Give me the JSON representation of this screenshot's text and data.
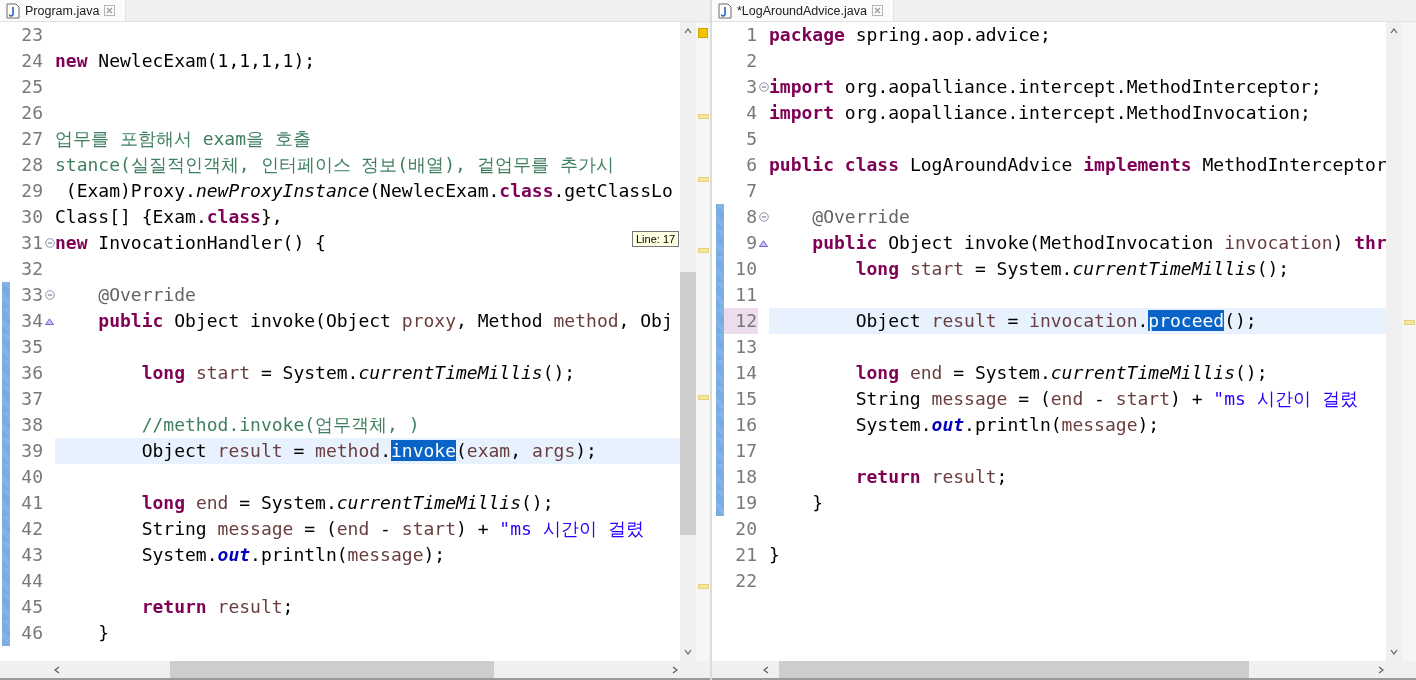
{
  "panes": [
    {
      "tab": {
        "title": "Program.java"
      },
      "focused": false,
      "tooltip": "Line: 17",
      "lines": [
        {
          "number": "23",
          "current": false
        },
        {
          "number": "24",
          "kind": "top",
          "current": false,
          "tokens": [
            {
              "kind": "keyword",
              "text": "new"
            },
            {
              "kind": "plain",
              "text": " NewlecExam(1,1,1,1);"
            }
          ]
        },
        {
          "number": "25",
          "current": false
        },
        {
          "number": "26",
          "current": false
        },
        {
          "number": "27",
          "kind": "top",
          "current": false,
          "tokens": [
            {
              "kind": "comment",
              "text": "업무를 포함해서 exam을 호출"
            }
          ]
        },
        {
          "number": "28",
          "kind": "top",
          "current": false,
          "tokens": [
            {
              "kind": "comment",
              "text": "stance(실질적인객체, 인터페이스 정보(배열), 겉업무를 추가시"
            }
          ]
        },
        {
          "number": "29",
          "kind": "top",
          "current": false,
          "tokens": [
            {
              "kind": "plain",
              "text": " (Exam)Proxy."
            },
            {
              "kind": "static",
              "text": "newProxyInstance"
            },
            {
              "kind": "plain",
              "text": "(NewlecExam."
            },
            {
              "kind": "keyword",
              "text": "class"
            },
            {
              "kind": "plain",
              "text": ".getClassLo"
            }
          ]
        },
        {
          "number": "30",
          "kind": "top",
          "current": false,
          "tokens": [
            {
              "kind": "plain",
              "text": "Class[] {Exam."
            },
            {
              "kind": "keyword",
              "text": "class"
            },
            {
              "kind": "plain",
              "text": "},"
            }
          ]
        },
        {
          "number": "31",
          "kind": "top",
          "current": false,
          "folding": true,
          "tokens": [
            {
              "kind": "keyword",
              "text": "new"
            },
            {
              "kind": "plain",
              "text": " InvocationHandler() {"
            }
          ]
        },
        {
          "number": "32",
          "current": false
        },
        {
          "number": "33",
          "kind": "member",
          "current": false,
          "folding": true,
          "changed": true,
          "tokens": [
            {
              "kind": "annotation",
              "text": "@Override"
            }
          ]
        },
        {
          "number": "34",
          "kind": "member",
          "current": false,
          "override": true,
          "changed": true,
          "tokens": [
            {
              "kind": "keyword",
              "text": "public"
            },
            {
              "kind": "plain",
              "text": " Object invoke(Object "
            },
            {
              "kind": "variable",
              "text": "proxy"
            },
            {
              "kind": "plain",
              "text": ", Method "
            },
            {
              "kind": "variable",
              "text": "method"
            },
            {
              "kind": "plain",
              "text": ", Obj"
            }
          ]
        },
        {
          "number": "35",
          "current": false,
          "changed": true
        },
        {
          "number": "36",
          "kind": "statement",
          "current": false,
          "changed": true,
          "tokens": [
            {
              "kind": "keyword",
              "text": "long "
            },
            {
              "kind": "variable",
              "text": "start"
            },
            {
              "kind": "plain",
              "text": " = System."
            },
            {
              "kind": "static",
              "text": "currentTimeMillis"
            },
            {
              "kind": "plain",
              "text": "();"
            }
          ]
        },
        {
          "number": "37",
          "current": false,
          "changed": true
        },
        {
          "number": "38",
          "kind": "statement",
          "current": false,
          "changed": true,
          "tokens": [
            {
              "kind": "comment",
              "text": "//method.invoke(업무객체, )"
            }
          ]
        },
        {
          "number": "39",
          "kind": "statement",
          "current": true,
          "changed": true,
          "tokens": [
            {
              "kind": "plain",
              "text": "Object "
            },
            {
              "kind": "variable",
              "text": "result"
            },
            {
              "kind": "plain",
              "text": " = "
            },
            {
              "kind": "variable",
              "text": "method"
            },
            {
              "kind": "plain",
              "text": "."
            },
            {
              "kind": "selection",
              "text": "invoke"
            },
            {
              "kind": "plain",
              "text": "("
            },
            {
              "kind": "variable",
              "text": "exam"
            },
            {
              "kind": "plain",
              "text": ", "
            },
            {
              "kind": "variable",
              "text": "args"
            },
            {
              "kind": "plain",
              "text": ");"
            }
          ]
        },
        {
          "number": "40",
          "current": false,
          "changed": true
        },
        {
          "number": "41",
          "kind": "statement",
          "current": false,
          "changed": true,
          "tokens": [
            {
              "kind": "keyword",
              "text": "long "
            },
            {
              "kind": "variable",
              "text": "end"
            },
            {
              "kind": "plain",
              "text": " = System."
            },
            {
              "kind": "static",
              "text": "currentTimeMillis"
            },
            {
              "kind": "plain",
              "text": "();"
            }
          ]
        },
        {
          "number": "42",
          "kind": "statement",
          "current": false,
          "changed": true,
          "tokens": [
            {
              "kind": "plain",
              "text": "String "
            },
            {
              "kind": "variable",
              "text": "message"
            },
            {
              "kind": "plain",
              "text": " = ("
            },
            {
              "kind": "variable",
              "text": "end"
            },
            {
              "kind": "plain",
              "text": " - "
            },
            {
              "kind": "variable",
              "text": "start"
            },
            {
              "kind": "plain",
              "text": ") + "
            },
            {
              "kind": "string",
              "text": "\"ms 시간이 걸렸"
            }
          ]
        },
        {
          "number": "43",
          "kind": "statement",
          "current": false,
          "changed": true,
          "tokens": [
            {
              "kind": "plain",
              "text": "System."
            },
            {
              "kind": "static_field",
              "text": "out"
            },
            {
              "kind": "plain",
              "text": ".println("
            },
            {
              "kind": "variable",
              "text": "message"
            },
            {
              "kind": "plain",
              "text": ");"
            }
          ]
        },
        {
          "number": "44",
          "current": false,
          "changed": true
        },
        {
          "number": "45",
          "kind": "statement",
          "current": false,
          "changed": true,
          "tokens": [
            {
              "kind": "keyword",
              "text": "return "
            },
            {
              "kind": "variable",
              "text": "result"
            },
            {
              "kind": "plain",
              "text": ";"
            }
          ]
        },
        {
          "number": "46",
          "kind": "member",
          "current": false,
          "changed": true,
          "tokens": [
            {
              "kind": "plain",
              "text": "}"
            }
          ]
        }
      ]
    },
    {
      "tab": {
        "title": "*LogAroundAdvice.java"
      },
      "focused": true,
      "lines": [
        {
          "number": "1",
          "kind": "top",
          "current": false,
          "tokens": [
            {
              "kind": "keyword",
              "text": "package"
            },
            {
              "kind": "plain",
              "text": " spring.aop.advice;"
            }
          ]
        },
        {
          "number": "2",
          "current": false
        },
        {
          "number": "3",
          "kind": "top",
          "current": false,
          "folding": true,
          "tokens": [
            {
              "kind": "keyword",
              "text": "import"
            },
            {
              "kind": "plain",
              "text": " org.aopalliance.intercept.MethodInterceptor;"
            }
          ]
        },
        {
          "number": "4",
          "kind": "top",
          "current": false,
          "tokens": [
            {
              "kind": "keyword",
              "text": "import"
            },
            {
              "kind": "plain",
              "text": " org.aopalliance.intercept.MethodInvocation;"
            }
          ]
        },
        {
          "number": "5",
          "current": false
        },
        {
          "number": "6",
          "kind": "top",
          "current": false,
          "tokens": [
            {
              "kind": "keyword",
              "text": "public class"
            },
            {
              "kind": "plain",
              "text": " LogAroundAdvice "
            },
            {
              "kind": "keyword",
              "text": "implements"
            },
            {
              "kind": "plain",
              "text": " MethodInterceptor"
            }
          ]
        },
        {
          "number": "7",
          "current": false
        },
        {
          "number": "8",
          "kind": "member",
          "current": false,
          "folding": true,
          "changed": true,
          "tokens": [
            {
              "kind": "annotation",
              "text": "@Override"
            }
          ]
        },
        {
          "number": "9",
          "kind": "member",
          "current": false,
          "override": true,
          "changed": true,
          "tokens": [
            {
              "kind": "keyword",
              "text": "public"
            },
            {
              "kind": "plain",
              "text": " Object invoke(MethodInvocation "
            },
            {
              "kind": "variable",
              "text": "invocation"
            },
            {
              "kind": "plain",
              "text": ") "
            },
            {
              "kind": "keyword",
              "text": "thr"
            }
          ]
        },
        {
          "number": "10",
          "kind": "statement",
          "current": false,
          "changed": true,
          "tokens": [
            {
              "kind": "keyword",
              "text": "long "
            },
            {
              "kind": "variable",
              "text": "start"
            },
            {
              "kind": "plain",
              "text": " = System."
            },
            {
              "kind": "static",
              "text": "currentTimeMillis"
            },
            {
              "kind": "plain",
              "text": "();"
            }
          ]
        },
        {
          "number": "11",
          "current": false,
          "changed": true
        },
        {
          "number": "12",
          "kind": "statement",
          "current": true,
          "changed": true,
          "tokens": [
            {
              "kind": "plain",
              "text": "Object "
            },
            {
              "kind": "variable",
              "text": "result"
            },
            {
              "kind": "plain",
              "text": " = "
            },
            {
              "kind": "variable",
              "text": "invocation"
            },
            {
              "kind": "plain",
              "text": "."
            },
            {
              "kind": "selection",
              "text": "proceed"
            },
            {
              "kind": "plain",
              "text": "();"
            }
          ]
        },
        {
          "number": "13",
          "current": false,
          "changed": true
        },
        {
          "number": "14",
          "kind": "statement",
          "current": false,
          "changed": true,
          "tokens": [
            {
              "kind": "keyword",
              "text": "long "
            },
            {
              "kind": "variable",
              "text": "end"
            },
            {
              "kind": "plain",
              "text": " = System."
            },
            {
              "kind": "static",
              "text": "currentTimeMillis"
            },
            {
              "kind": "plain",
              "text": "();"
            }
          ]
        },
        {
          "number": "15",
          "kind": "statement",
          "current": false,
          "changed": true,
          "tokens": [
            {
              "kind": "plain",
              "text": "String "
            },
            {
              "kind": "variable",
              "text": "message"
            },
            {
              "kind": "plain",
              "text": " = ("
            },
            {
              "kind": "variable",
              "text": "end"
            },
            {
              "kind": "plain",
              "text": " - "
            },
            {
              "kind": "variable",
              "text": "start"
            },
            {
              "kind": "plain",
              "text": ") + "
            },
            {
              "kind": "string",
              "text": "\"ms 시간이 걸렸"
            }
          ]
        },
        {
          "number": "16",
          "kind": "statement",
          "current": false,
          "changed": true,
          "tokens": [
            {
              "kind": "plain",
              "text": "System."
            },
            {
              "kind": "static_field",
              "text": "out"
            },
            {
              "kind": "plain",
              "text": ".println("
            },
            {
              "kind": "variable",
              "text": "message"
            },
            {
              "kind": "plain",
              "text": ");"
            }
          ]
        },
        {
          "number": "17",
          "current": false,
          "changed": true
        },
        {
          "number": "18",
          "kind": "statement",
          "current": false,
          "changed": true,
          "tokens": [
            {
              "kind": "keyword",
              "text": "return "
            },
            {
              "kind": "variable",
              "text": "result"
            },
            {
              "kind": "plain",
              "text": ";"
            }
          ]
        },
        {
          "number": "19",
          "kind": "member",
          "current": false,
          "changed": true,
          "tokens": [
            {
              "kind": "plain",
              "text": "}"
            }
          ]
        },
        {
          "number": "20",
          "current": false
        },
        {
          "number": "21",
          "kind": "top",
          "current": false,
          "tokens": [
            {
              "kind": "plain",
              "text": "}"
            }
          ]
        },
        {
          "number": "22",
          "current": false
        }
      ]
    }
  ]
}
